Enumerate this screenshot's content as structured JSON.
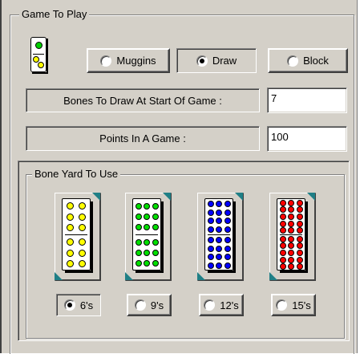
{
  "game_group": {
    "title": "Game To Play",
    "modes": [
      {
        "label": "Muggins",
        "selected": false
      },
      {
        "label": "Draw",
        "selected": true
      },
      {
        "label": "Block",
        "selected": false
      }
    ],
    "bones_label": "Bones To Draw At Start Of Game :",
    "bones_value": "7",
    "points_label": "Points In A Game :",
    "points_value": "100"
  },
  "boneyard_group": {
    "title": "Bone Yard To Use",
    "sets": [
      {
        "label": "6's",
        "selected": true,
        "pip_color": "#ffff00",
        "pips_per_half": 6,
        "cols": 2
      },
      {
        "label": "9's",
        "selected": false,
        "pip_color": "#00e000",
        "pips_per_half": 9,
        "cols": 3
      },
      {
        "label": "12's",
        "selected": false,
        "pip_color": "#0000ff",
        "pips_per_half": 12,
        "cols": 3
      },
      {
        "label": "15's",
        "selected": false,
        "pip_color": "#ff0000",
        "pips_per_half": 15,
        "cols": 3
      }
    ]
  },
  "colors": {
    "face": "#d4d0c8",
    "tile_corner": "#1f7f86"
  },
  "icons": {
    "game_icon": "domino-icon"
  }
}
